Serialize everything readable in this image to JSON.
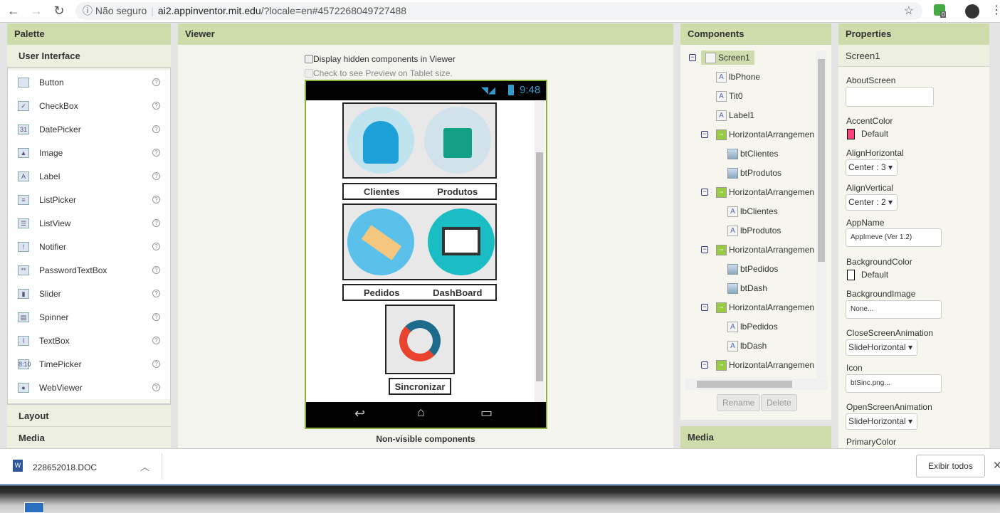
{
  "browser": {
    "security": "Não seguro",
    "host": "ai2.appinventor.mit.edu",
    "path": "/?locale=en#4572268049727488",
    "ext_badge": "0"
  },
  "palette": {
    "title": "Palette",
    "section": "User Interface",
    "items": [
      "Button",
      "CheckBox",
      "DatePicker",
      "Image",
      "Label",
      "ListPicker",
      "ListView",
      "Notifier",
      "PasswordTextBox",
      "Slider",
      "Spinner",
      "TextBox",
      "TimePicker",
      "WebViewer"
    ],
    "help": "?",
    "sections_below": [
      "Layout",
      "Media"
    ]
  },
  "viewer": {
    "title": "Viewer",
    "hidden_checkbox": "Display hidden components in Viewer",
    "tablet_checkbox": "Check to see Preview on Tablet size.",
    "time": "9:48",
    "labels": {
      "clientes": "Clientes",
      "produtos": "Produtos",
      "pedidos": "Pedidos",
      "dashboard": "DashBoard",
      "sincronizar": "Sincronizar"
    },
    "nonvisible": "Non-visible components"
  },
  "components": {
    "title": "Components",
    "tree": [
      {
        "name": "Screen1",
        "type": "screen",
        "level": 0
      },
      {
        "name": "lbPhone",
        "type": "label",
        "level": 1
      },
      {
        "name": "Tit0",
        "type": "label",
        "level": 1
      },
      {
        "name": "Label1",
        "type": "label",
        "level": 1
      },
      {
        "name": "HorizontalArrangemen",
        "type": "ha",
        "level": 1
      },
      {
        "name": "btClientes",
        "type": "button",
        "level": 2
      },
      {
        "name": "btProdutos",
        "type": "button",
        "level": 2
      },
      {
        "name": "HorizontalArrangemen",
        "type": "ha",
        "level": 1
      },
      {
        "name": "lbClientes",
        "type": "label",
        "level": 2
      },
      {
        "name": "lbProdutos",
        "type": "label",
        "level": 2
      },
      {
        "name": "HorizontalArrangemen",
        "type": "ha",
        "level": 1
      },
      {
        "name": "btPedidos",
        "type": "button",
        "level": 2
      },
      {
        "name": "btDash",
        "type": "button",
        "level": 2
      },
      {
        "name": "HorizontalArrangemen",
        "type": "ha",
        "level": 1
      },
      {
        "name": "lbPedidos",
        "type": "label",
        "level": 2
      },
      {
        "name": "lbDash",
        "type": "label",
        "level": 2
      },
      {
        "name": "HorizontalArrangemen",
        "type": "ha",
        "level": 1
      }
    ],
    "rename": "Rename",
    "delete": "Delete",
    "media_title": "Media"
  },
  "properties": {
    "title": "Properties",
    "component": "Screen1",
    "about_label": "AboutScreen",
    "about_value": "",
    "accent_label": "AccentColor",
    "accent_value": "Default",
    "accent_color": "#ff4081",
    "alignh_label": "AlignHorizontal",
    "alignh_value": "Center : 3",
    "alignv_label": "AlignVertical",
    "alignv_value": "Center : 2",
    "appname_label": "AppName",
    "appname_value": "AppImeve (Ver 1.2)",
    "bgcolor_label": "BackgroundColor",
    "bgcolor_value": "Default",
    "bgcolor_color": "#ffffff",
    "bgimage_label": "BackgroundImage",
    "bgimage_value": "None...",
    "close_label": "CloseScreenAnimation",
    "close_value": "SlideHorizontal",
    "icon_label": "Icon",
    "icon_value": "btSinc.png...",
    "open_label": "OpenScreenAnimation",
    "open_value": "SlideHorizontal",
    "primary_label": "PrimaryColor"
  },
  "downloads": {
    "file": "228652018.DOC",
    "show_all": "Exibir todos"
  }
}
